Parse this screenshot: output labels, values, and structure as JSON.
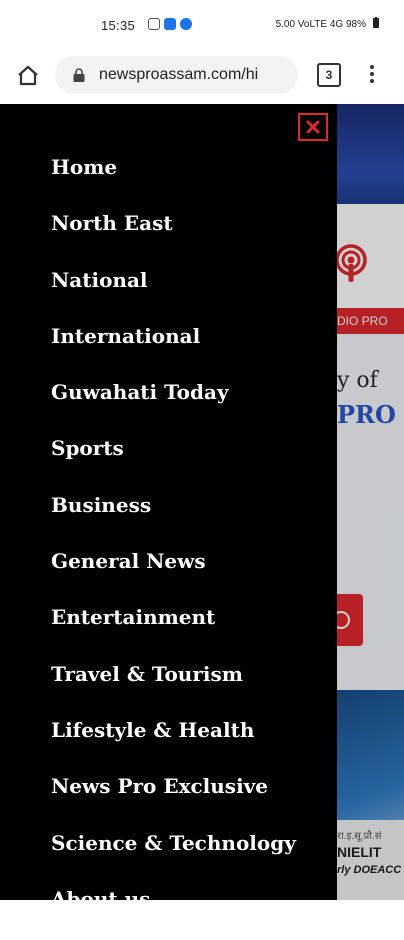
{
  "status_bar": {
    "time": "15:35",
    "right_text": "5.00 VoLTE 4G 98%"
  },
  "browser": {
    "url": "newsproassam.com/hi",
    "tab_count": "3"
  },
  "background_page": {
    "radio_label": "DIO PRO",
    "heading_line1": "y of",
    "heading_line2": "PRO",
    "caption_line1": "रा.इ.सू.प्रौ.सं",
    "caption_line2": "NIELIT",
    "caption_line3": "rly DOEACC"
  },
  "drawer": {
    "close_color": "#e0282e",
    "items": [
      {
        "label": "Home"
      },
      {
        "label": "North East"
      },
      {
        "label": "National"
      },
      {
        "label": "International"
      },
      {
        "label": "Guwahati Today"
      },
      {
        "label": "Sports"
      },
      {
        "label": "Business"
      },
      {
        "label": "General News"
      },
      {
        "label": "Entertainment"
      },
      {
        "label": "Travel & Tourism"
      },
      {
        "label": "Lifestyle & Health"
      },
      {
        "label": "News Pro Exclusive"
      },
      {
        "label": "Science & Technology"
      },
      {
        "label": "About us"
      }
    ]
  }
}
